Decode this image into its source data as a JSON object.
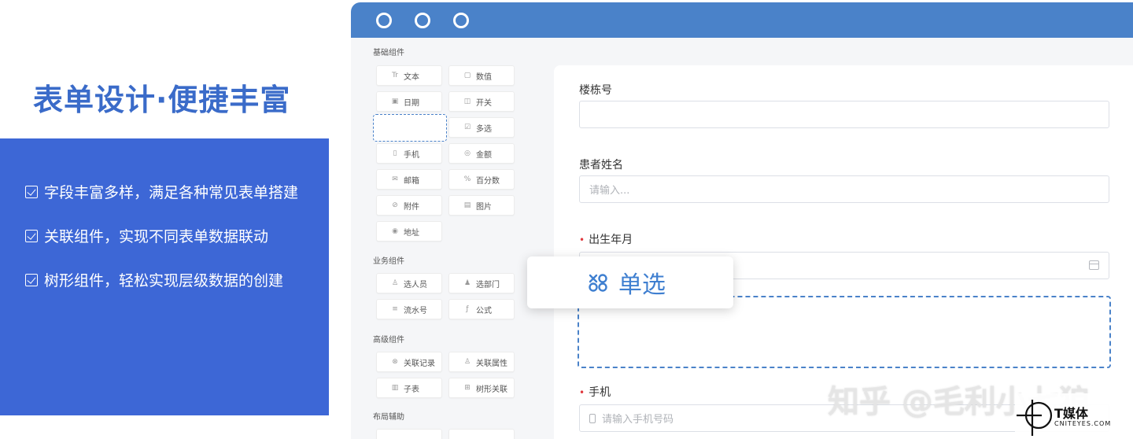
{
  "promo": {
    "title": "表单设计·便捷丰富",
    "items": [
      "字段丰富多样，满足各种常见表单搭建",
      "关联组件，实现不同表单数据联动",
      "树形组件，轻松实现层级数据的创建"
    ]
  },
  "palette": {
    "sections": [
      "基础组件",
      "业务组件",
      "高级组件",
      "布局辅助"
    ],
    "basic": [
      {
        "label": "文本",
        "icon": "Tr"
      },
      {
        "label": "数值",
        "icon": "▢"
      },
      {
        "label": "日期",
        "icon": "▣"
      },
      {
        "label": "开关",
        "icon": "◫"
      },
      {
        "label": "多选",
        "icon": "☑"
      },
      {
        "label": "手机",
        "icon": "▯"
      },
      {
        "label": "金额",
        "icon": "◎"
      },
      {
        "label": "邮箱",
        "icon": "✉"
      },
      {
        "label": "百分数",
        "icon": "%"
      },
      {
        "label": "附件",
        "icon": "⊘"
      },
      {
        "label": "图片",
        "icon": "▤"
      },
      {
        "label": "地址",
        "icon": "◉"
      }
    ],
    "business": [
      {
        "label": "选人员",
        "icon": "♙"
      },
      {
        "label": "选部门",
        "icon": "♟"
      },
      {
        "label": "流水号",
        "icon": "≡"
      },
      {
        "label": "公式",
        "icon": "ƒ"
      }
    ],
    "advanced": [
      {
        "label": "关联记录",
        "icon": "⊗"
      },
      {
        "label": "关联属性",
        "icon": "♙"
      },
      {
        "label": "子表",
        "icon": "▥"
      },
      {
        "label": "树形关联",
        "icon": "⊞"
      }
    ]
  },
  "form": {
    "fields": [
      {
        "label": "楼栋号",
        "placeholder": "",
        "required": false
      },
      {
        "label": "患者姓名",
        "placeholder": "请输入...",
        "required": false
      },
      {
        "label": "出生年月",
        "placeholder": "",
        "required": true
      },
      {
        "label": "手机",
        "placeholder": "请输入手机号码",
        "required": true
      }
    ]
  },
  "drag_chip": {
    "label": "单选",
    "icon": "radio-group-icon"
  },
  "watermark": {
    "text": "知乎 @毛利小七狼"
  },
  "brand": {
    "name": "T媒体",
    "sub": "CNITEYES.COM"
  },
  "colors": {
    "accent": "#3d67d6",
    "titlebar": "#4a82c9",
    "required": "#e0393e"
  }
}
